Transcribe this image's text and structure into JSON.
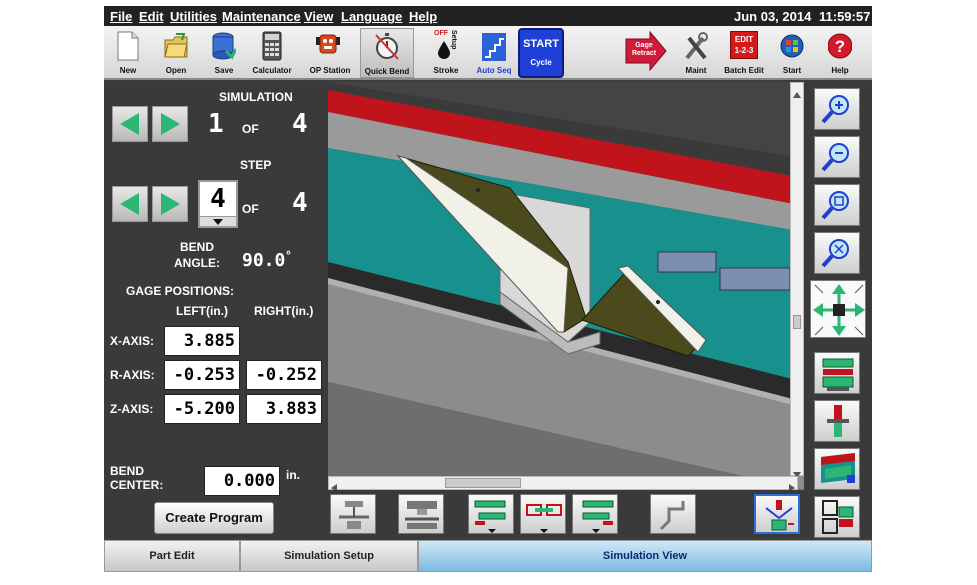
{
  "menu": {
    "items": [
      "File",
      "Edit",
      "Utilities",
      "Maintenance",
      "View",
      "Language",
      "Help"
    ],
    "date": "Jun 03, 2014",
    "time": "11:59:57"
  },
  "toolbar": {
    "new": "New",
    "open": "Open",
    "save": "Save",
    "calculator": "Calculator",
    "op_station": "OP Station",
    "quick_bend": "Quick Bend",
    "stroke_setup": "Setup",
    "stroke_off": "OFF",
    "stroke": "Stroke",
    "auto_seq": "Auto Seq",
    "start_cycle_top": "START",
    "start_cycle_bottom": "Cycle",
    "gage_retract": "Gage\nRetract",
    "maint": "Maint",
    "batch_edit_icon": "EDIT\n1-2-3",
    "batch_edit": "Batch Edit",
    "start": "Start",
    "help": "Help"
  },
  "simulation": {
    "title": "SIMULATION",
    "current": "1",
    "of": "OF",
    "total": "4"
  },
  "step": {
    "title": "STEP",
    "current": "4",
    "of": "OF",
    "total": "4"
  },
  "bend_angle": {
    "label_line1": "BEND",
    "label_line2": "ANGLE:",
    "value": "90.0",
    "unit": "°"
  },
  "gage": {
    "title": "GAGE POSITIONS:",
    "left_header": "LEFT(in.)",
    "right_header": "RIGHT(in.)",
    "rows": [
      {
        "label": "X-AXIS:",
        "left": "3.885",
        "right": ""
      },
      {
        "label": "R-AXIS:",
        "left": "-0.253",
        "right": "-0.252"
      },
      {
        "label": "Z-AXIS:",
        "left": "-5.200",
        "right": "3.883"
      }
    ]
  },
  "bend_center": {
    "label_line1": "BEND",
    "label_line2": "CENTER:",
    "value": "0.000",
    "unit": "in."
  },
  "create_program": "Create Program",
  "tabs": [
    "Part Edit",
    "Simulation Setup",
    "Simulation View"
  ],
  "active_tab": "Simulation View",
  "colors": {
    "menubar_bg": "#222222",
    "panel_bg": "#3a3a3a",
    "arrow_green": "#2bb673",
    "start_blue": "#1f3fd6",
    "press_red": "#c0141c",
    "teal": "#18918e",
    "part_olive": "#4a4a1c",
    "active_tab": "#7cbbe3"
  }
}
